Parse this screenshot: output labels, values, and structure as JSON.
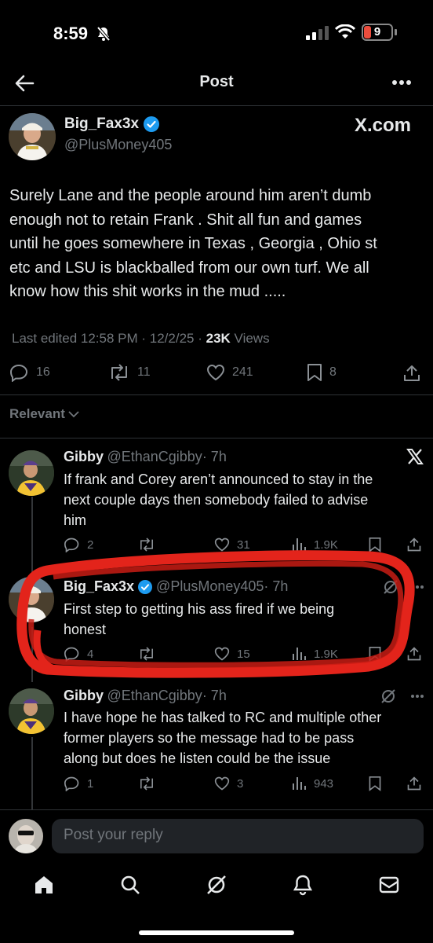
{
  "status_bar": {
    "time": "8:59",
    "battery": "9"
  },
  "header": {
    "title": "Post"
  },
  "post": {
    "author_name": "Big_Fax3x",
    "author_handle": "@PlusMoney405",
    "source": "X.com",
    "text_lines": [
      "Surely Lane and the people around him aren’t dumb",
      "enough not to retain Frank . Shit all fun and games",
      "until he goes somewhere in Texas , Georgia , Ohio st",
      "etc and LSU is blackballed from our own turf. We all",
      "know how this shit works in the mud ....."
    ],
    "edited": "Last edited 12:58 PM · 12/2/25 ·",
    "views_count": "23K",
    "views_label": "Views",
    "replies": "16",
    "reposts": "11",
    "likes": "241",
    "bookmarks": "8"
  },
  "sort_label": "Relevant",
  "replies": [
    {
      "name": "Gibby",
      "handle": "@EthanCgibby",
      "time": "· 7h",
      "lines": [
        "If frank and Corey aren’t announced to stay in the",
        "next couple days then somebody failed to advise",
        "him"
      ],
      "replies": "2",
      "likes": "31",
      "views": "1.9K"
    },
    {
      "name": "Big_Fax3x",
      "handle": "@PlusMoney405",
      "time": "· 7h",
      "lines": [
        "First step to getting his ass fired if we being",
        "honest"
      ],
      "replies": "4",
      "likes": "15",
      "views": "1.9K"
    },
    {
      "name": "Gibby",
      "handle": "@EthanCgibby",
      "time": "· 7h",
      "lines": [
        "I have hope he has talked to RC and multiple other",
        "former players so the message had to be pass",
        "along but does he listen could be the issue"
      ],
      "replies": "1",
      "likes": "3",
      "views": "943"
    }
  ],
  "composer": {
    "placeholder": "Post your reply"
  },
  "colors": {
    "verified": "#1d9bf0",
    "annotation": "#e3241b",
    "muted": "#71767b"
  }
}
